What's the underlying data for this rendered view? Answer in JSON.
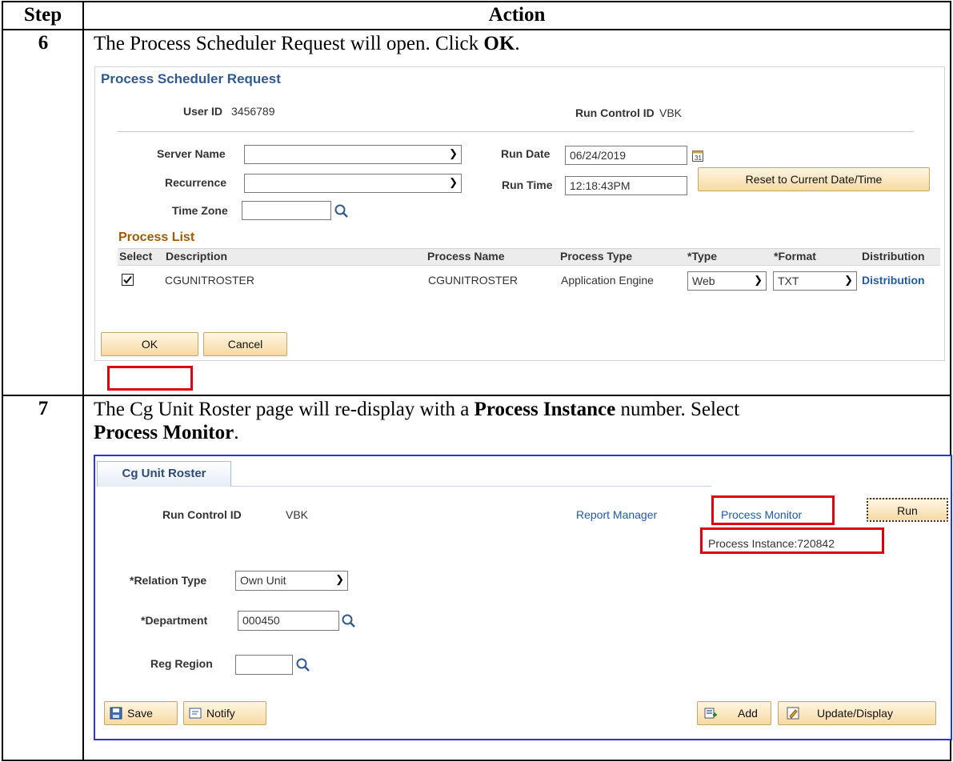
{
  "doc_header": {
    "step": "Step",
    "action": "Action"
  },
  "step6": {
    "number": "6",
    "text_before": "The Process Scheduler Request will open.  Click ",
    "text_bold": "OK",
    "text_after": "."
  },
  "scheduler": {
    "title": "Process Scheduler Request",
    "user_id_label": "User ID",
    "user_id": "3456789",
    "run_control_label": "Run Control ID",
    "run_control_id": "VBK",
    "server_name_label": "Server Name",
    "server_name": "",
    "recurrence_label": "Recurrence",
    "recurrence": "",
    "time_zone_label": "Time Zone",
    "time_zone": "",
    "run_date_label": "Run Date",
    "run_date": "06/24/2019",
    "run_time_label": "Run Time",
    "run_time": "12:18:43PM",
    "reset_button": "Reset to Current Date/Time",
    "process_list_title": "Process List",
    "columns": {
      "select": "Select",
      "description": "Description",
      "process_name": "Process Name",
      "process_type": "Process Type",
      "type": "*Type",
      "format": "*Format",
      "distribution": "Distribution"
    },
    "row": {
      "selected": true,
      "description": "CGUNITROSTER",
      "process_name": "CGUNITROSTER",
      "process_type": "Application Engine",
      "type": "Web",
      "format": "TXT",
      "distribution": "Distribution"
    },
    "ok_button": "OK",
    "cancel_button": "Cancel"
  },
  "step7": {
    "number": "7",
    "line1_before": "The Cg Unit Roster page will re-display with a ",
    "line1_bold": "Process Instance",
    "line1_after": " number.  Select",
    "line2_bold": "Process Monitor",
    "line2_after": "."
  },
  "roster": {
    "tab": "Cg Unit Roster",
    "run_control_label": "Run Control ID",
    "run_control_id": "VBK",
    "report_manager": "Report Manager",
    "process_monitor": "Process Monitor",
    "run_button": "Run",
    "process_instance": "Process Instance:720842",
    "relation_type_label": "*Relation Type",
    "relation_type": "Own Unit",
    "department_label": "*Department",
    "department": "000450",
    "reg_region_label": "Reg Region",
    "reg_region": "",
    "save_button": "Save",
    "notify_button": "Notify",
    "add_button": "Add",
    "update_display_button": "Update/Display"
  },
  "colors": {
    "highlight": "#e00010",
    "frame_blue": "#2a36d6",
    "ps_title": "#2f5a90",
    "section_title": "#a05a00",
    "link": "#1f5ca8"
  }
}
